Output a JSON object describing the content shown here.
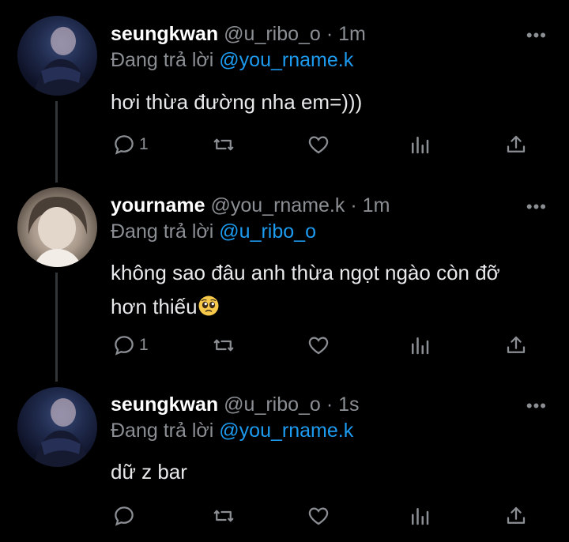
{
  "tweets": [
    {
      "name": "seungkwan",
      "handle": "@u_ribo_o",
      "time": "· 1m",
      "reply_prefix": "Đang trả lời",
      "reply_to": "@you_rname.k",
      "text": "hơi thừa đường nha em=)))",
      "reply_count": "1"
    },
    {
      "name": "yourname",
      "handle": "@you_rname.k",
      "time": "· 1m",
      "reply_prefix": "Đang trả lời",
      "reply_to": "@u_ribo_o",
      "text_line1": "không sao đâu anh thừa ngọt ngào còn đỡ",
      "text_line2": "hơn thiếu",
      "reply_count": "1"
    },
    {
      "name": "seungkwan",
      "handle": "@u_ribo_o",
      "time": "· 1s",
      "reply_prefix": "Đang trả lời",
      "reply_to": "@you_rname.k",
      "text": "dữ z bar",
      "reply_count": ""
    }
  ],
  "more_label": "•••",
  "icons": [
    "reply-icon",
    "retweet-icon",
    "like-icon",
    "views-icon",
    "share-icon",
    "pleading-face-emoji"
  ]
}
